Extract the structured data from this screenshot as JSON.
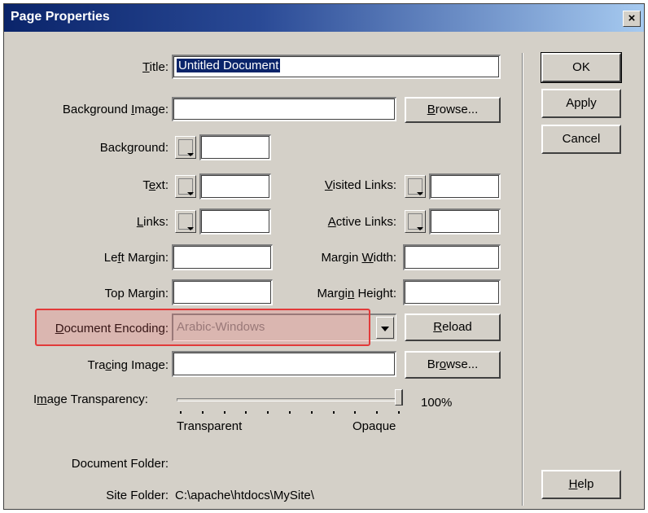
{
  "window": {
    "title": "Page Properties",
    "close_glyph": "×"
  },
  "labels": {
    "title_prefix": "",
    "title_accel": "T",
    "title_rest": "itle:",
    "bg_image_prefix": "Background ",
    "bg_image_accel": "I",
    "bg_image_rest": "mage:",
    "background": "Background:",
    "text_prefix": "T",
    "text_accel": "e",
    "text_rest": "xt:",
    "visited_prefix": "",
    "visited_accel": "V",
    "visited_rest": "isited Links:",
    "links_prefix": "",
    "links_accel": "L",
    "links_rest": "inks:",
    "active_prefix": "",
    "active_accel": "A",
    "active_rest": "ctive Links:",
    "left_margin_prefix": "Le",
    "left_margin_accel": "f",
    "left_margin_rest": "t Margin:",
    "margin_width_prefix": "Margin ",
    "margin_width_accel": "W",
    "margin_width_rest": "idth:",
    "top_margin": "Top Margin:",
    "margin_height_prefix": "Margi",
    "margin_height_accel": "n",
    "margin_height_rest": " Height:",
    "encoding_prefix": "",
    "encoding_accel": "D",
    "encoding_rest": "ocument Encoding:",
    "tracing_prefix": "Tra",
    "tracing_accel": "c",
    "tracing_rest": "ing Image:",
    "transparency_prefix": "I",
    "transparency_accel": "m",
    "transparency_rest": "age Transparency:",
    "transparent": "Transparent",
    "opaque": "Opaque",
    "transparency_value": "100%",
    "document_folder": "Document Folder:",
    "site_folder": "Site Folder:"
  },
  "fields": {
    "title_value": "Untitled Document",
    "background_image": "",
    "background_color": "",
    "text_color": "",
    "visited_links_color": "",
    "links_color": "",
    "active_links_color": "",
    "left_margin": "",
    "margin_width": "",
    "top_margin": "",
    "margin_height": "",
    "encoding": "Arabic-Windows",
    "tracing_image": "",
    "document_folder_value": "",
    "site_folder_value": "C:\\apache\\htdocs\\MySite\\"
  },
  "slider": {
    "transparency_percent": 100
  },
  "buttons": {
    "ok": "OK",
    "apply": "Apply",
    "cancel": "Cancel",
    "help_accel": "H",
    "help_rest": "elp",
    "browse1_prefix": "",
    "browse1_accel": "B",
    "browse1_rest": "rowse...",
    "browse2_prefix": "Br",
    "browse2_accel": "o",
    "browse2_rest": "wse...",
    "reload_prefix": "",
    "reload_accel": "R",
    "reload_rest": "eload"
  },
  "colors": {
    "dialog_bg": "#d4d0c8",
    "titlebar": "#0a246a",
    "highlight": "#e23a3a"
  }
}
